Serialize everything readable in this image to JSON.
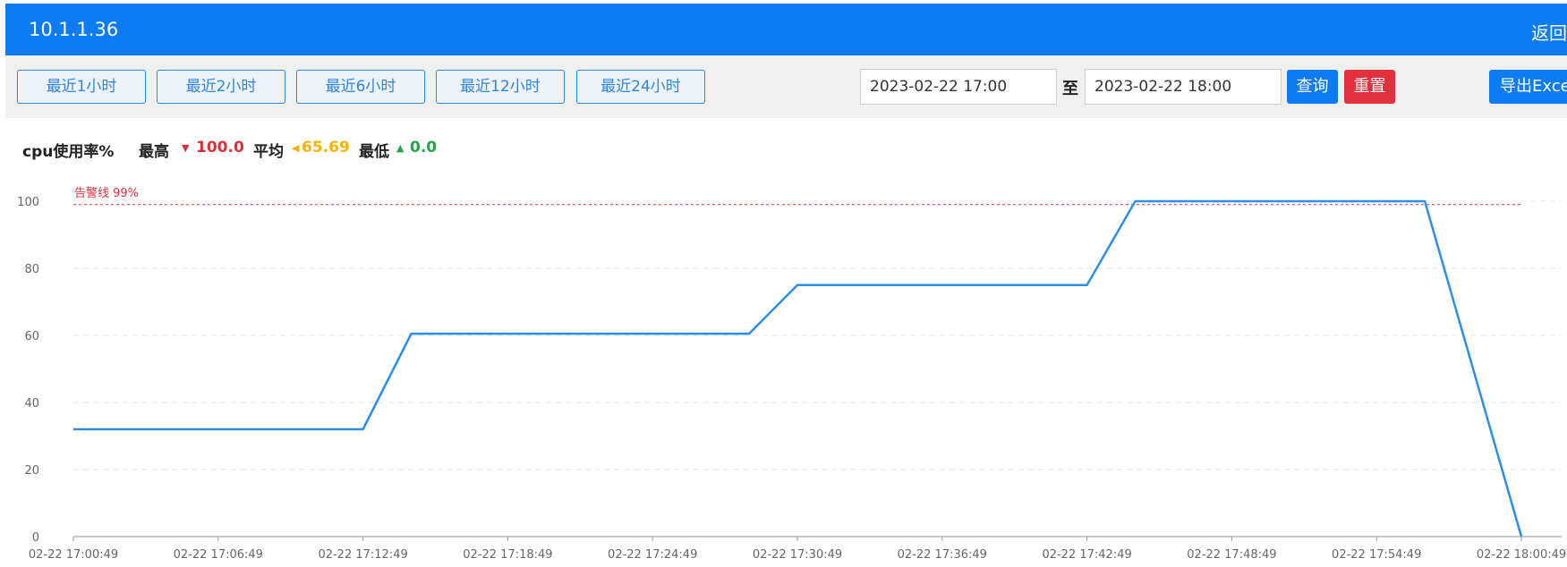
{
  "header": {
    "title": "10.1.1.36",
    "back_label": "返回"
  },
  "toolbar": {
    "range_buttons": [
      "最近1小时",
      "最近2小时",
      "最近6小时",
      "最近12小时",
      "最近24小时"
    ],
    "start_value": "2023-02-22 17:00",
    "separator": "至",
    "end_value": "2023-02-22 18:00",
    "query_label": "查询",
    "reset_label": "重置",
    "export_label": "导出Excel"
  },
  "stats": {
    "metric": "cpu使用率%",
    "max_label": "最高",
    "max_value": "100.0",
    "avg_label": "平均",
    "avg_value": "65.69",
    "min_label": "最低",
    "min_value": "0.0"
  },
  "colors": {
    "primary": "#0d7cf2",
    "danger": "#e2303f",
    "line": "#2b8fe8",
    "alarm": "#e2303f"
  },
  "chart_data": {
    "type": "line",
    "x": [
      "17:00:49",
      "17:06:49",
      "17:12:49",
      "17:14:49",
      "17:18:49",
      "17:24:49",
      "17:28:49",
      "17:30:49",
      "17:36:49",
      "17:42:49",
      "17:44:49",
      "17:48:49",
      "17:54:49",
      "17:56:49",
      "18:00:49"
    ],
    "y": [
      32,
      32,
      32,
      60.5,
      60.5,
      60.5,
      60.5,
      75,
      75,
      75,
      100,
      100,
      100,
      100,
      0
    ],
    "xticks": [
      "02-22 17:00:49",
      "02-22 17:06:49",
      "02-22 17:12:49",
      "02-22 17:18:49",
      "02-22 17:24:49",
      "02-22 17:30:49",
      "02-22 17:36:49",
      "02-22 17:42:49",
      "02-22 17:48:49",
      "02-22 17:54:49",
      "02-22 18:00:49"
    ],
    "yticks": [
      0,
      20,
      40,
      60,
      80,
      100
    ],
    "ylim": [
      0,
      100
    ],
    "threshold": {
      "value": 99,
      "label": "告警线 99%"
    },
    "grid": true
  }
}
